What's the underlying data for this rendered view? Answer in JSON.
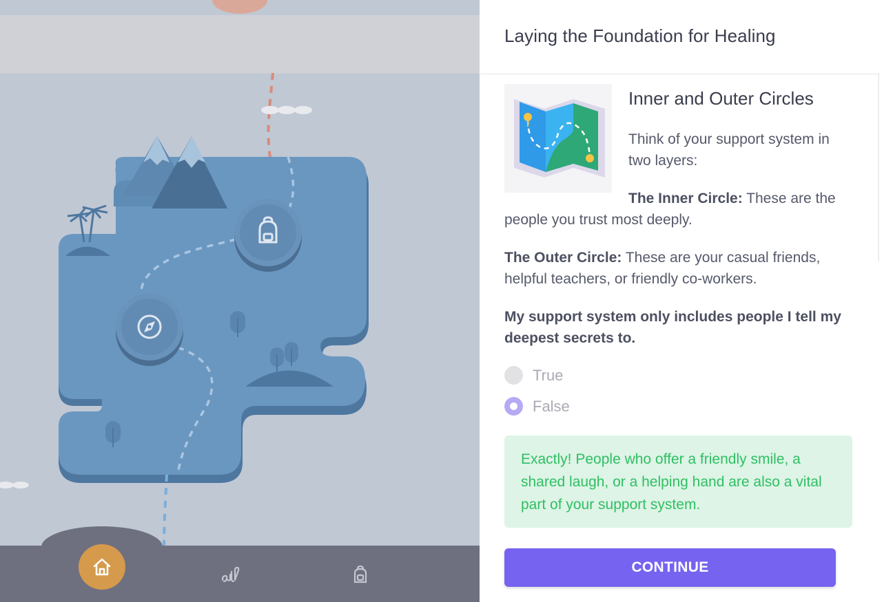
{
  "map": {
    "nodes": [
      {
        "name": "backpack-node",
        "icon": "backpack-icon"
      },
      {
        "name": "compass-node",
        "icon": "compass-icon"
      }
    ]
  },
  "bottom_nav": {
    "items": [
      {
        "icon": "home-icon",
        "active": true
      },
      {
        "icon": "journal-icon",
        "active": false
      },
      {
        "icon": "backpack-icon",
        "active": false
      }
    ]
  },
  "panel": {
    "title": "Laying the Foundation for Healing",
    "lesson": {
      "image_icon": "map-icon",
      "heading": "Inner and Outer Circles",
      "intro": "Think of your support system in two layers:",
      "inner_label": "The Inner Circle:",
      "inner_text": " These are the people you trust most deeply.",
      "outer_label": "The Outer Circle:",
      "outer_text": " These are your casual friends, helpful teachers, or friendly co-workers."
    },
    "question": "My support system only includes people I tell my deepest secrets to.",
    "options": [
      {
        "label": "True",
        "selected": false
      },
      {
        "label": "False",
        "selected": true
      }
    ],
    "feedback": "Exactly! People who offer a friendly smile, a shared laugh, or a helping hand are also a vital part of your support system.",
    "continue_label": "CONTINUE"
  },
  "colors": {
    "accent": "#7663f0",
    "success_text": "#2fbf63",
    "success_bg": "#ddf4e6",
    "nav_active": "#d59a4c",
    "map_water": "#6a97c0"
  }
}
